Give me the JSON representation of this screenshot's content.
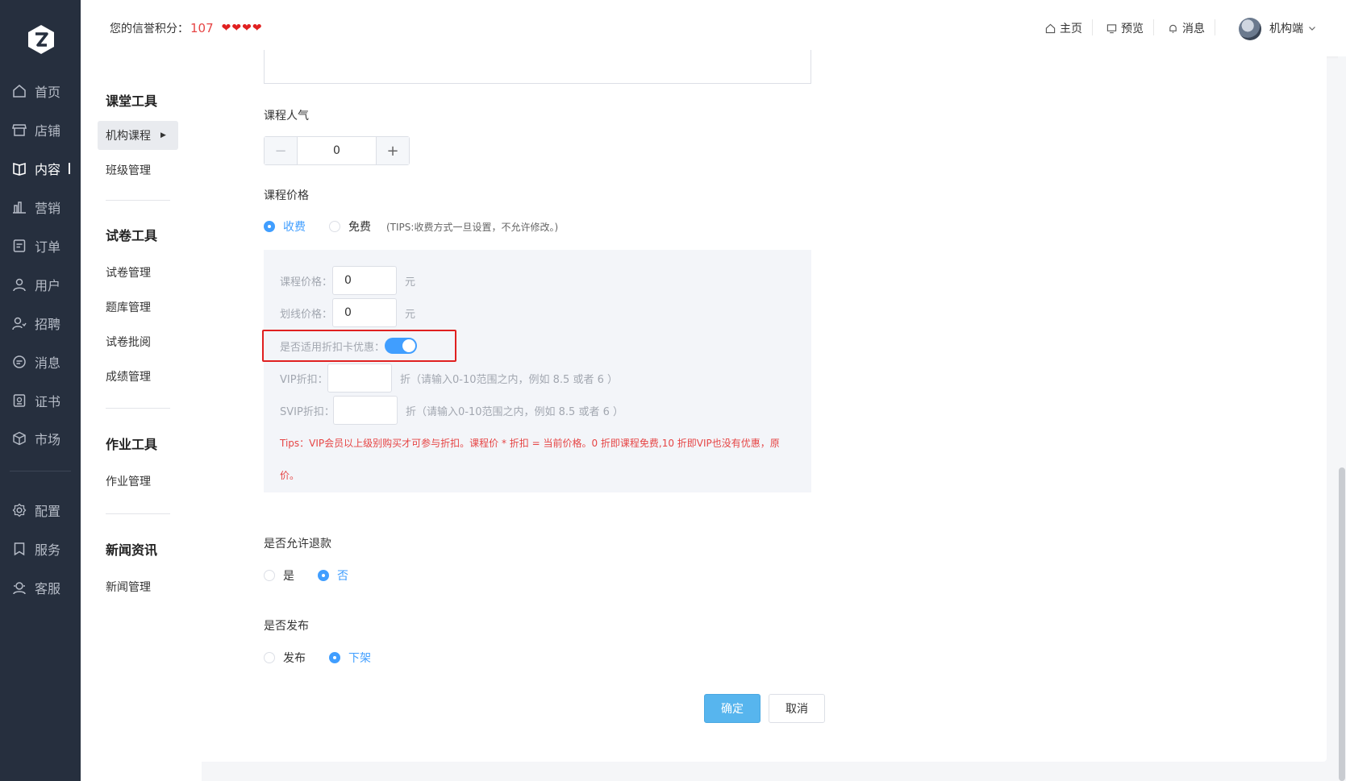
{
  "header": {
    "credit_label": "您的信誉积分：",
    "credit_value": "107",
    "hearts": [
      "❤",
      "❤",
      "❤",
      "❤"
    ],
    "nav": [
      {
        "icon": "home-icon",
        "label": "主页"
      },
      {
        "icon": "monitor-icon",
        "label": "预览"
      },
      {
        "icon": "bell-icon",
        "label": "消息"
      }
    ],
    "user_name": "机构端"
  },
  "sidebar": {
    "logo": "Z",
    "items": [
      {
        "icon": "home-icon",
        "label": "首页"
      },
      {
        "icon": "store-icon",
        "label": "店铺"
      },
      {
        "icon": "book-icon",
        "label": "内容",
        "active": true
      },
      {
        "icon": "bar-chart-icon",
        "label": "营销"
      },
      {
        "icon": "order-icon",
        "label": "订单"
      },
      {
        "icon": "user-icon",
        "label": "用户"
      },
      {
        "icon": "recruit-icon",
        "label": "招聘"
      },
      {
        "icon": "message-icon",
        "label": "消息"
      },
      {
        "icon": "certificate-icon",
        "label": "证书"
      },
      {
        "icon": "market-icon",
        "label": "市场"
      }
    ],
    "bottom_items": [
      {
        "icon": "gear-icon",
        "label": "配置"
      },
      {
        "icon": "bookmark-icon",
        "label": "服务"
      },
      {
        "icon": "support-icon",
        "label": "客服"
      }
    ]
  },
  "submenu": {
    "groups": [
      {
        "title": "课堂工具",
        "items": [
          "机构课程",
          "班级管理"
        ]
      },
      {
        "title": "试卷工具",
        "items": [
          "试卷管理",
          "题库管理",
          "试卷批阅",
          "成绩管理"
        ]
      },
      {
        "title": "作业工具",
        "items": [
          "作业管理"
        ]
      },
      {
        "title": "新闻资讯",
        "items": [
          "新闻管理"
        ]
      }
    ]
  },
  "form": {
    "popularity_label": "课程人气",
    "popularity_value": "0",
    "price_label": "课程价格",
    "price_mode": {
      "paid": "收费",
      "free": "免费",
      "selected": "收费",
      "tips": "(TIPS:收费方式一旦设置，不允许修改。)"
    },
    "course_price_label": "课程价格：",
    "course_price_value": "0",
    "strike_price_label": "划线价格：",
    "strike_price_value": "0",
    "unit": "元",
    "discount_card_label": "是否适用折扣卡优惠：",
    "discount_card_enabled": true,
    "vip_label": "VIP折扣：",
    "vip_value": "",
    "vip_hint": "折（请输入0-10范围之内，例如 8.5 或者 6 ）",
    "svip_label": "SVIP折扣：",
    "svip_value": "",
    "svip_hint": "折（请输入0-10范围之内，例如 8.5 或者 6 ）",
    "red_tip_line1": "Tips：VIP会员以上级别购买才可参与折扣。课程价 * 折扣 = 当前价格。0 折即课程免费,10 折即VIP也没有优惠，原",
    "red_tip_line2": "价。",
    "refund_label": "是否允许退款",
    "refund_options": {
      "yes": "是",
      "no": "否",
      "selected": "否"
    },
    "publish_label": "是否发布",
    "publish_options": {
      "publish": "发布",
      "unpublish": "下架",
      "selected": "下架"
    },
    "confirm": "确定",
    "cancel": "取消"
  },
  "colors": {
    "sidebar_bg": "#262f3e",
    "accent": "#409eff",
    "confirm_bg": "#57b5ee",
    "tip_red": "#e64545",
    "highlight_frame": "#e02020"
  }
}
